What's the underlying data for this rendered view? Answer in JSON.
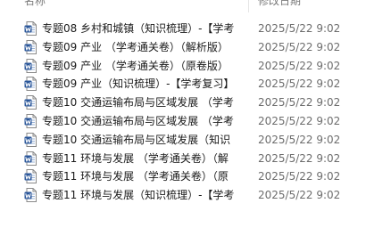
{
  "header": {
    "name_label": "名称",
    "date_label": "修改日期"
  },
  "colors": {
    "word_blue": "#2b579a",
    "text": "#1a1a1a",
    "date_text": "#6d6d6d"
  },
  "files": [
    {
      "icon": "word-document-icon",
      "name": "专题08 乡村和城镇（知识梳理）-【学考",
      "date": "2025/5/22 9:02"
    },
    {
      "icon": "word-document-icon",
      "name": "专题09 产业 （学考通关卷）（解析版）",
      "date": "2025/5/22 9:02"
    },
    {
      "icon": "word-document-icon",
      "name": "专题09 产业 （学考通关卷）（原卷版）",
      "date": "2025/5/22 9:02"
    },
    {
      "icon": "word-document-icon",
      "name": "专题09 产业（知识梳理）-【学考复习】",
      "date": "2025/5/22 9:02"
    },
    {
      "icon": "word-document-icon",
      "name": "专题10 交通运输布局与区域发展 （学考",
      "date": "2025/5/22 9:02"
    },
    {
      "icon": "word-document-icon",
      "name": "专题10 交通运输布局与区域发展 （学考",
      "date": "2025/5/22 9:02"
    },
    {
      "icon": "word-document-icon",
      "name": "专题10 交通运输布局与区域发展（知识",
      "date": "2025/5/22 9:02"
    },
    {
      "icon": "word-document-icon",
      "name": "专题11 环境与发展 （学考通关卷）（解",
      "date": "2025/5/22 9:02"
    },
    {
      "icon": "word-document-icon",
      "name": "专题11 环境与发展 （学考通关卷）（原",
      "date": "2025/5/22 9:02"
    },
    {
      "icon": "word-document-icon",
      "name": "专题11 环境与发展（知识梳理）-【学考",
      "date": "2025/5/22 9:02"
    }
  ]
}
